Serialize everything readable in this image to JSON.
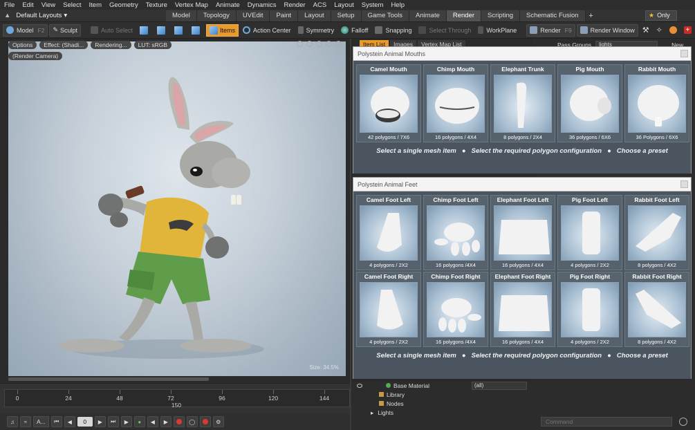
{
  "menubar": [
    "File",
    "Edit",
    "View",
    "Select",
    "Item",
    "Geometry",
    "Texture",
    "Vertex Map",
    "Animate",
    "Dynamics",
    "Render",
    "ACS",
    "Layout",
    "System",
    "Help"
  ],
  "layoutbar": {
    "layout_select": "Default Layouts",
    "tabs": [
      "Model",
      "Topology",
      "UVEdit",
      "Paint",
      "Layout",
      "Setup",
      "Game Tools",
      "Animate",
      "Render",
      "Scripting",
      "Schematic Fusion"
    ],
    "active_tab": "Render",
    "only_label": "Only"
  },
  "toolbar": {
    "model": "Model",
    "model_key": "F2",
    "sculpt": "Sculpt",
    "auto_select": "Auto Select",
    "items": "Items",
    "action_center": "Action Center",
    "symmetry": "Symmetry",
    "falloff": "Falloff",
    "snapping": "Snapping",
    "select_through": "Select Through",
    "workplane": "WorkPlane",
    "render": "Render",
    "render_key": "F9",
    "render_window": "Render Window"
  },
  "viewport": {
    "chips": [
      "Options",
      "Effect: (Shadi...",
      "Rendering...",
      "LUT: sRGB",
      "(Render Camera)"
    ],
    "size_label": "Size: 34.5%"
  },
  "timeline": {
    "major_labels": [
      "0",
      "24",
      "48",
      "72",
      "96",
      "120",
      "144"
    ],
    "sub_labels": [
      "150"
    ]
  },
  "transport": {
    "a_select": "A...",
    "frame": "0"
  },
  "rightpane": {
    "tabs": [
      "Item List",
      "Images",
      "Vertex Map List"
    ],
    "tree": [
      {
        "label": "Base Material",
        "value": "(all)"
      },
      {
        "label": "Library"
      },
      {
        "label": "Nodes"
      },
      {
        "label": "Lights"
      }
    ]
  },
  "farright": {
    "pass_groups_label": "Pass Groups",
    "pass_groups_value": "lights",
    "new_label": "New",
    "command_placeholder": "Command"
  },
  "mouths_panel": {
    "title": "Polystein Animal Mouths",
    "items": [
      {
        "label": "Camel Mouth",
        "foot": "42 polygons / 7X6"
      },
      {
        "label": "Chimp Mouth",
        "foot": "16 polygons / 4X4"
      },
      {
        "label": "Elephant Trunk",
        "foot": "8 polygons / 2X4"
      },
      {
        "label": "Pig Mouth",
        "foot": "36 polygons / 6X6"
      },
      {
        "label": "Rabbit Mouth",
        "foot": "36 Polygons / 6X6"
      }
    ],
    "hint": [
      "Select a single mesh item",
      "Select the required polygon configuration",
      "Choose a preset"
    ]
  },
  "feet_panel": {
    "title": "Polystein Animal Feet",
    "row1": [
      {
        "label": "Camel Foot Left",
        "foot": "4 polygons / 2X2"
      },
      {
        "label": "Chimp Foot Left",
        "foot": "16 polygons /4X4"
      },
      {
        "label": "Elephant Foot Left",
        "foot": "16 polygons / 4X4"
      },
      {
        "label": "Pig Foot Left",
        "foot": "4 polygons / 2X2"
      },
      {
        "label": "Rabbit Foot Left",
        "foot": "8 polygons / 4X2"
      }
    ],
    "row2": [
      {
        "label": "Camel Foot Right",
        "foot": "4 polygons / 2X2"
      },
      {
        "label": "Chimp Foot Right",
        "foot": "16 polygons /4X4"
      },
      {
        "label": "Elephant Foot Right",
        "foot": "16 polygons / 4X4"
      },
      {
        "label": "Pig Foot Right",
        "foot": "4 polygons / 2X2"
      },
      {
        "label": "Rabbit Foot Right",
        "foot": "8 polygons / 4X2"
      }
    ],
    "hint": [
      "Select a single mesh item",
      "Select the required polygon configuration",
      "Choose a preset"
    ]
  }
}
